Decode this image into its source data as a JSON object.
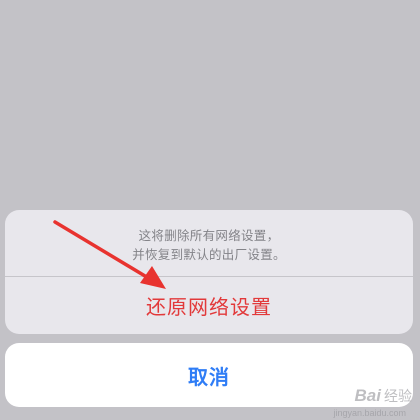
{
  "action_sheet": {
    "message_line1": "这将删除所有网络设置，",
    "message_line2": "并恢复到默认的出厂设置。",
    "destructive_label": "还原网络设置"
  },
  "cancel_label": "取消",
  "annotation": {
    "arrow_color": "#e8332f"
  },
  "watermark": {
    "logo": "Bai",
    "text": "经验",
    "url": "jingyan.baidu.com"
  },
  "colors": {
    "background": "#c3c2c7",
    "sheet_background": "#e8e7ec",
    "destructive": "#e2393a",
    "cancel": "#2f7df6"
  }
}
